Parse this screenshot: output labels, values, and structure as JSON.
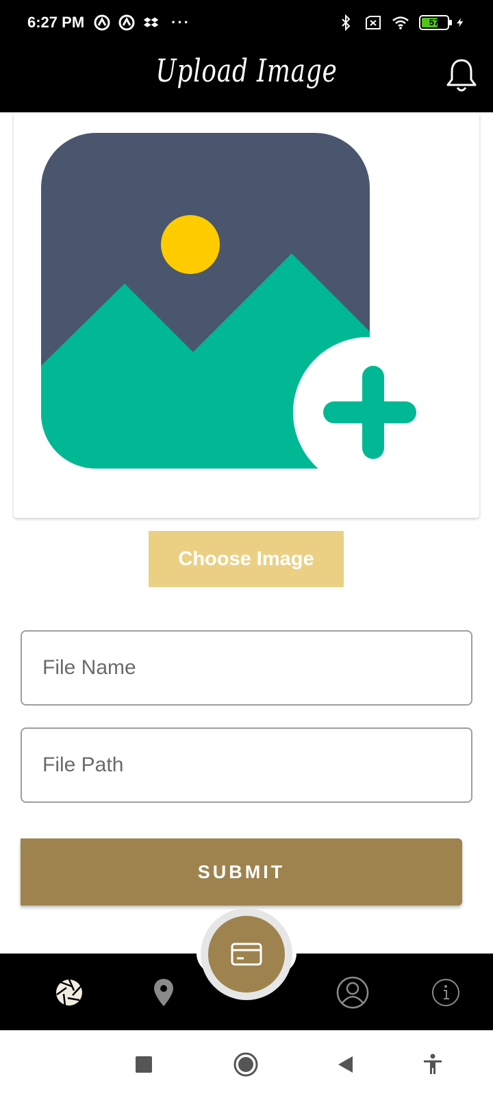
{
  "status_bar": {
    "time": "6:27 PM",
    "battery": "57",
    "icons": [
      "vpn-icon",
      "vpn-icon",
      "dropbox-icon",
      "more-dots-icon",
      "bluetooth-icon",
      "sim-icon",
      "wifi-icon",
      "battery-icon",
      "charging-icon"
    ]
  },
  "header": {
    "title": "Upload Image",
    "bell_icon": "bell-icon"
  },
  "image_card": {
    "placeholder_icon": "add-image-icon",
    "colors": {
      "sky": "#4a566e",
      "sun": "#ffcc00",
      "mountain": "#00b894"
    }
  },
  "choose_button": {
    "label": "Choose Image",
    "color": "#ebd084"
  },
  "form": {
    "file_name": {
      "placeholder": "File Name",
      "value": ""
    },
    "file_path": {
      "placeholder": "File Path",
      "value": ""
    }
  },
  "submit_button": {
    "label": "SUBMIT",
    "color": "#9e834f"
  },
  "bottom_nav": {
    "items": [
      {
        "icon": "camera-shutter-icon",
        "active": true
      },
      {
        "icon": "location-pin-icon",
        "active": false
      },
      {
        "icon": "card-icon",
        "active": false
      },
      {
        "icon": "profile-icon",
        "active": false
      },
      {
        "icon": "info-icon",
        "active": false
      }
    ]
  },
  "system_nav": {
    "icons": [
      "recents-icon",
      "home-icon",
      "back-icon",
      "accessibility-icon"
    ]
  }
}
